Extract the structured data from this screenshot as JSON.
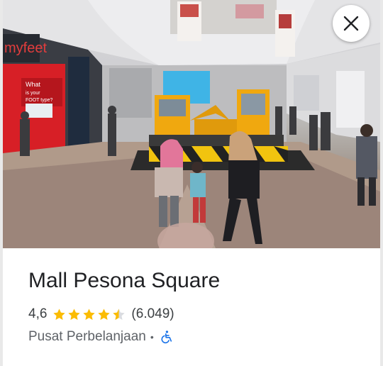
{
  "place": {
    "name": "Mall Pesona Square",
    "rating": "4,6",
    "stars_filled": 4.5,
    "reviews_count": "(6.049)",
    "category": "Pusat Perbelanjaan",
    "separator": "•"
  },
  "photo": {
    "store_sign": "myfeet",
    "screen_text_1": "What",
    "screen_text_2": "is your",
    "screen_text_3": "FOOT type?"
  },
  "controls": {
    "close_label": "Close"
  },
  "colors": {
    "star": "#fbbc04",
    "accessibility_icon": "#1a73e8",
    "title": "#202124"
  },
  "icons": {
    "close": "close-icon",
    "accessibility": "wheelchair-icon"
  }
}
